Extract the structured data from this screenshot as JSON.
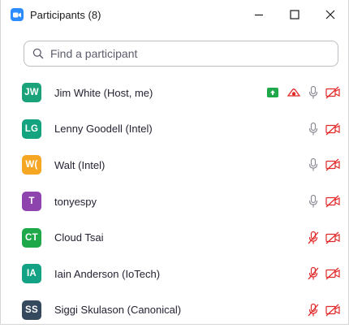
{
  "window": {
    "title": "Participants (8)"
  },
  "search": {
    "placeholder": "Find a participant"
  },
  "participants": [
    {
      "initials": "JW",
      "name": "Jim White (Host, me)",
      "color": "#1aa37a",
      "sharing": true,
      "recording": true,
      "mic": "on",
      "video": "off"
    },
    {
      "initials": "LG",
      "name": "Lenny Goodell (Intel)",
      "color": "#14a37f",
      "sharing": false,
      "recording": false,
      "mic": "on",
      "video": "off"
    },
    {
      "initials": "W(",
      "name": "Walt (Intel)",
      "color": "#f5a623",
      "sharing": false,
      "recording": false,
      "mic": "on",
      "video": "off"
    },
    {
      "initials": "T",
      "name": "tonyespy",
      "color": "#8e44ad",
      "sharing": false,
      "recording": false,
      "mic": "on",
      "video": "off"
    },
    {
      "initials": "CT",
      "name": "Cloud Tsai",
      "color": "#1ea84a",
      "sharing": false,
      "recording": false,
      "mic": "muted",
      "video": "off"
    },
    {
      "initials": "IA",
      "name": "Iain Anderson (IoTech)",
      "color": "#13a384",
      "sharing": false,
      "recording": false,
      "mic": "muted",
      "video": "off"
    },
    {
      "initials": "SS",
      "name": "Siggi Skulason (Canonical)",
      "color": "#34495e",
      "sharing": false,
      "recording": false,
      "mic": "muted",
      "video": "off"
    }
  ],
  "colors": {
    "accent": "#2d8cff",
    "muted_red": "#e02828",
    "icon_gray": "#8c8c96"
  }
}
